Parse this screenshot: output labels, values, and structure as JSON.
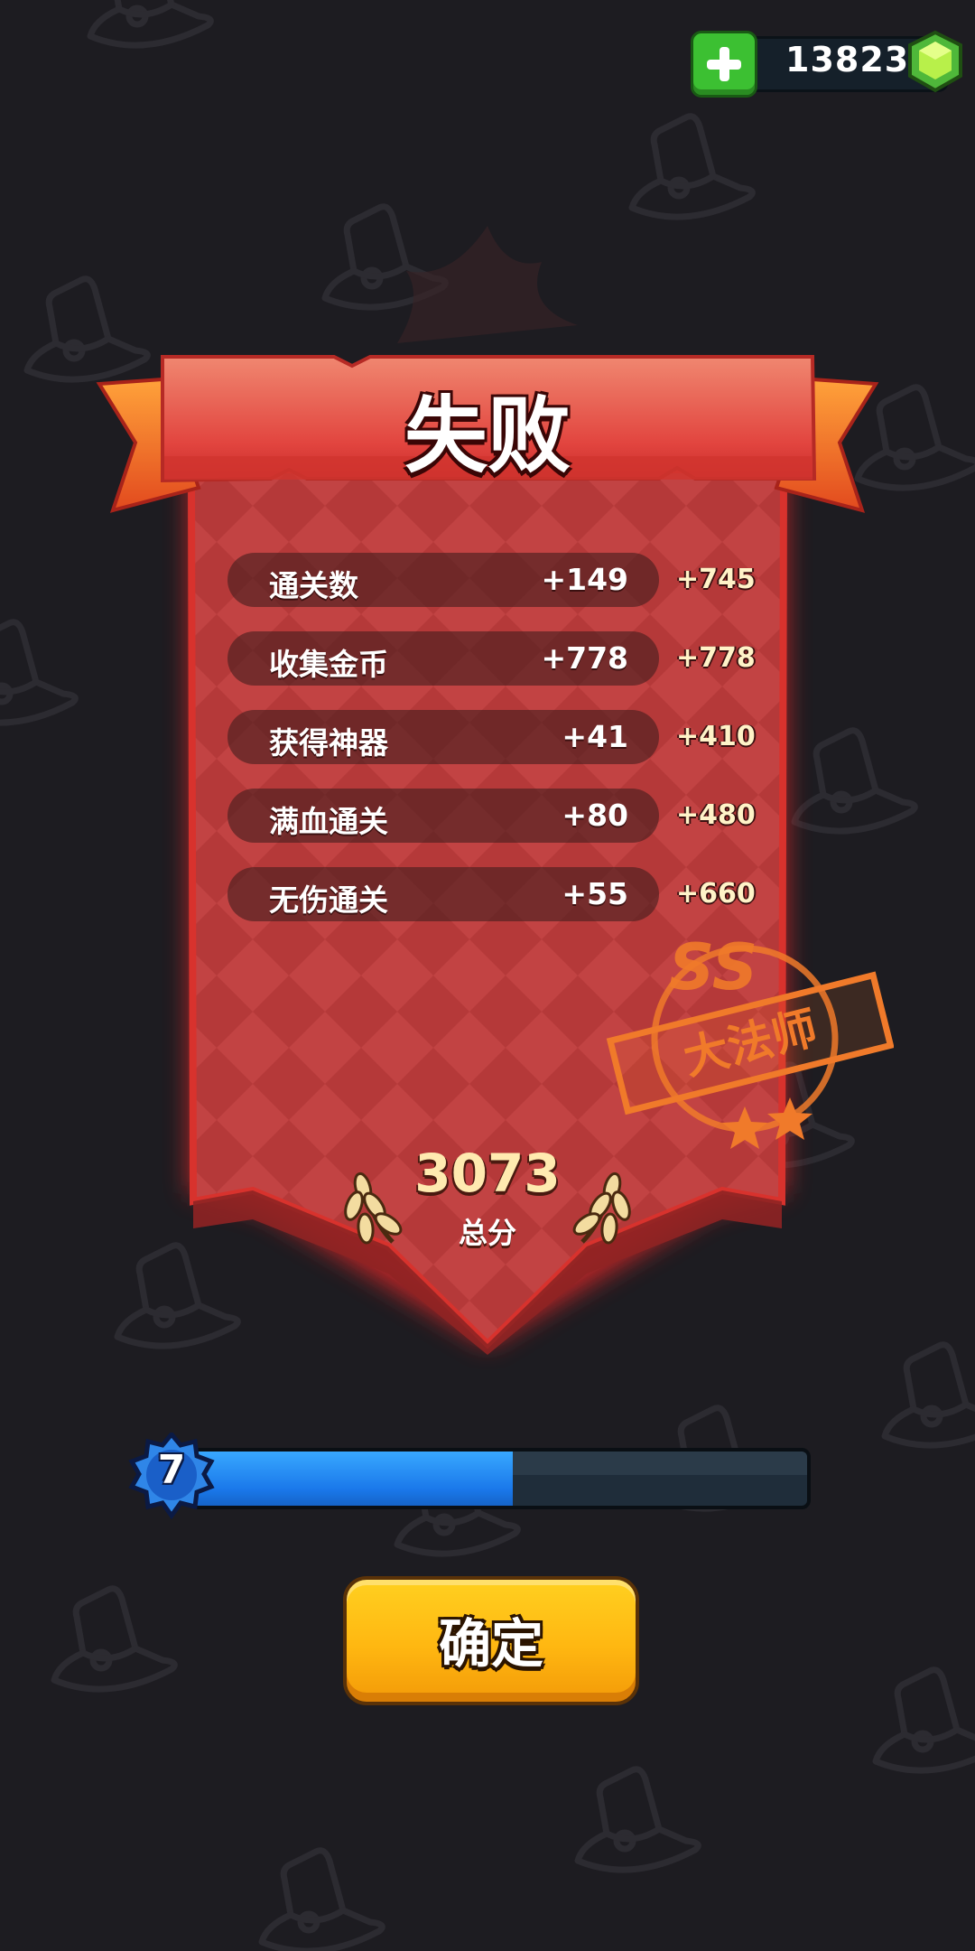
{
  "currency": {
    "amount": "13823",
    "icons": [
      "plus-icon",
      "green-gem-icon"
    ]
  },
  "result": {
    "title": "失败"
  },
  "stats": [
    {
      "label": "通关数",
      "value": "+149",
      "score": "+745"
    },
    {
      "label": "收集金币",
      "value": "+778",
      "score": "+778"
    },
    {
      "label": "获得神器",
      "value": "+41",
      "score": "+410"
    },
    {
      "label": "满血通关",
      "value": "+80",
      "score": "+480"
    },
    {
      "label": "无伤通关",
      "value": "+55",
      "score": "+660"
    }
  ],
  "stamp": {
    "grade": "SS",
    "title": "大法师"
  },
  "total": {
    "value": "3073",
    "label": "总分"
  },
  "level": {
    "number": "7",
    "progress": 0.52
  },
  "confirm": {
    "label": "确定"
  },
  "colors": {
    "panel": "#b73a3a",
    "banner": "#e8574e",
    "button": "#ffb711",
    "level_fill": "#1a78ea",
    "stamp": "#f07a2a"
  }
}
